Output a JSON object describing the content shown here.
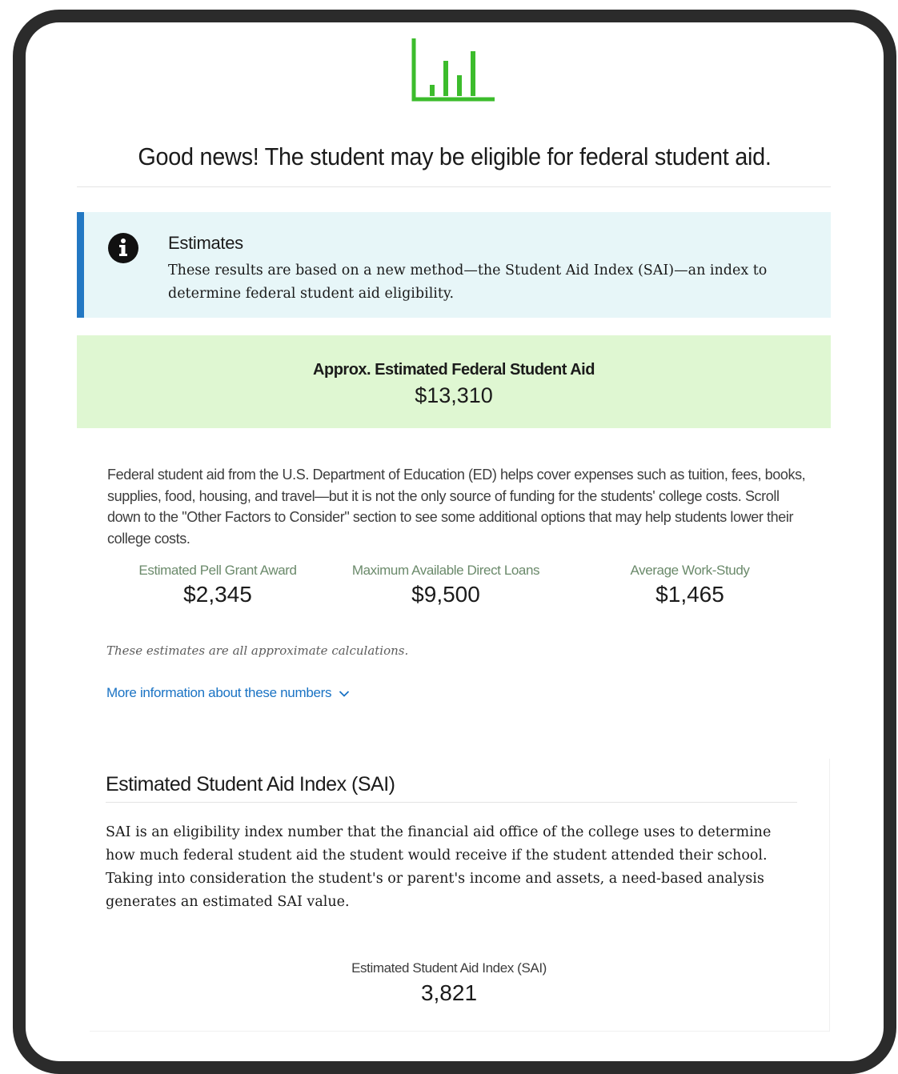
{
  "header": {
    "icon": "bar-chart-icon",
    "icon_color": "#3cbc2c",
    "headline": "Good news! The student may be eligible for federal student aid."
  },
  "alert": {
    "icon": "info-icon",
    "accent_color": "#2378c3",
    "title": "Estimates",
    "body": "These results are based on a new method—the Student Aid Index (SAI)—an index to determine federal student aid eligibility."
  },
  "summary": {
    "background": "#dff7d2",
    "label": "Approx. Estimated Federal Student Aid",
    "value": "$13,310"
  },
  "description": "Federal student aid from the U.S. Department of Education (ED) helps cover expenses such as tuition, fees, books, supplies, food, housing, and travel—but it is not the only source of funding for the students' college costs. Scroll down to the \"Other Factors to Consider\" section to see some additional options that may help students lower their college costs.",
  "stats": [
    {
      "label": "Estimated Pell Grant Award",
      "value": "$2,345"
    },
    {
      "label": "Maximum Available Direct Loans",
      "value": "$9,500"
    },
    {
      "label": "Average Work-Study",
      "value": "$1,465"
    }
  ],
  "note": "These estimates are all approximate calculations.",
  "more_link": "More information about these numbers",
  "sai": {
    "heading": "Estimated Student Aid Index (SAI)",
    "body": "SAI is an eligibility index number that the financial aid office of the college uses to determine how much federal student aid the student would receive if the student attended their school. Taking into consideration the student's or parent's income and assets, a need-based analysis generates an estimated SAI value.",
    "label": "Estimated Student Aid Index (SAI)",
    "value": "3,821"
  }
}
